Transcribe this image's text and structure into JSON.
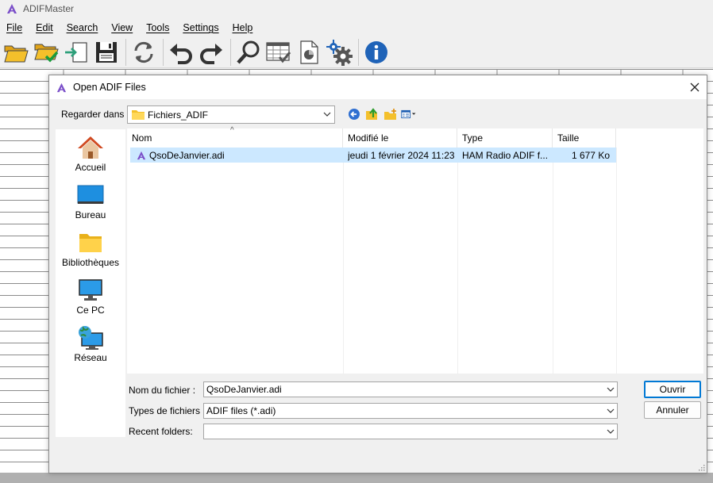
{
  "app": {
    "title": "ADIFMaster",
    "menu": [
      "File",
      "Edit",
      "Search",
      "View",
      "Tools",
      "Settings",
      "Help"
    ],
    "toolbar": [
      {
        "name": "open-folder-icon"
      },
      {
        "name": "open-verified-icon"
      },
      {
        "name": "import-icon"
      },
      {
        "name": "save-icon"
      },
      {
        "name": "refresh-icon"
      },
      {
        "name": "undo-icon"
      },
      {
        "name": "redo-icon"
      },
      {
        "name": "search-icon"
      },
      {
        "name": "table-check-icon"
      },
      {
        "name": "report-icon"
      },
      {
        "name": "settings-icon"
      },
      {
        "name": "info-icon"
      }
    ]
  },
  "dialog": {
    "title": "Open ADIF Files",
    "look_in_label": "Regarder dans :",
    "look_in_value": "Fichiers_ADIF",
    "places": [
      "Accueil",
      "Bureau",
      "Bibliothèques",
      "Ce PC",
      "Réseau"
    ],
    "columns": [
      "Nom",
      "Modifié le",
      "Type",
      "Taille"
    ],
    "files": [
      {
        "name": "QsoDeJanvier.adi",
        "modified": "jeudi 1 février 2024 11:23",
        "type": "HAM Radio ADIF f...",
        "size": "1 677 Ko"
      }
    ],
    "filename_label": "Nom du fichier :",
    "filename_value": "QsoDeJanvier.adi",
    "filetype_label": "Types de fichiers :",
    "filetype_value": "ADIF files (*.adi)",
    "recent_label": "Recent folders:",
    "recent_value": "",
    "open_button": "Ouvrir",
    "cancel_button": "Annuler"
  },
  "colors": {
    "accent": "#0078d4",
    "selection": "#cce8ff",
    "logo": "#7b4fc9"
  }
}
